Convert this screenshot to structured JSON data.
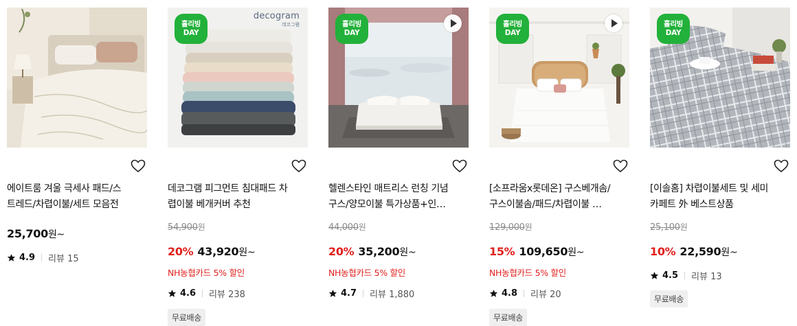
{
  "badge": {
    "line1": "홀리빙",
    "line2": "DAY"
  },
  "colors": {
    "badge": "#22b13a",
    "discount": "#e0201c"
  },
  "icons": {
    "wishlist": "heart-outline-icon",
    "rating": "star-icon",
    "video": "play-icon"
  },
  "products": [
    {
      "title_line1": "에이트룸 겨울 극세사 패드/스",
      "title_line2": "트레드/차렵이불/세트 모음전",
      "price": "25,700",
      "won_suffix": "원~",
      "rating": "4.9",
      "reviews": "리뷰 15"
    },
    {
      "brand": "decogram",
      "brand_sub": "데코그램",
      "title_line1": "데코그램 피그먼트 침대패드 차",
      "title_line2": "렵이불 베개커버 추천",
      "original_price": "54,900",
      "original_won": "원",
      "discount_rate": "20%",
      "price": "43,920",
      "won_suffix": "원~",
      "card_discount": "NH농협카드 5% 할인",
      "rating": "4.6",
      "reviews": "리뷰 238",
      "shipping": "무료배송"
    },
    {
      "title_line1": "헬렌스타인 매트리스 런칭 기념",
      "title_line2": "구스/양모이불 특가상품+인…",
      "original_price": "44,000",
      "original_won": "원",
      "discount_rate": "20%",
      "price": "35,200",
      "won_suffix": "원~",
      "card_discount": "NH농협카드 5% 할인",
      "rating": "4.7",
      "reviews": "리뷰 1,880"
    },
    {
      "title_line1": "[소프라움x롯데온] 구스베개솜/",
      "title_line2": "구스이불솜/패드/차렵이불 …",
      "original_price": "129,000",
      "original_won": "원",
      "discount_rate": "15%",
      "price": "109,650",
      "won_suffix": "원~",
      "card_discount": "NH농협카드 5% 할인",
      "rating": "4.8",
      "reviews": "리뷰 20",
      "shipping": "무료배송"
    },
    {
      "title_line1": "[이솔홈] 차렵이불세트 및 세미",
      "title_line2": "카페트 外 베스트상품",
      "original_price": "25,100",
      "original_won": "원",
      "discount_rate": "10%",
      "price": "22,590",
      "won_suffix": "원~",
      "rating": "4.5",
      "reviews": "리뷰 13",
      "shipping": "무료배송"
    }
  ]
}
